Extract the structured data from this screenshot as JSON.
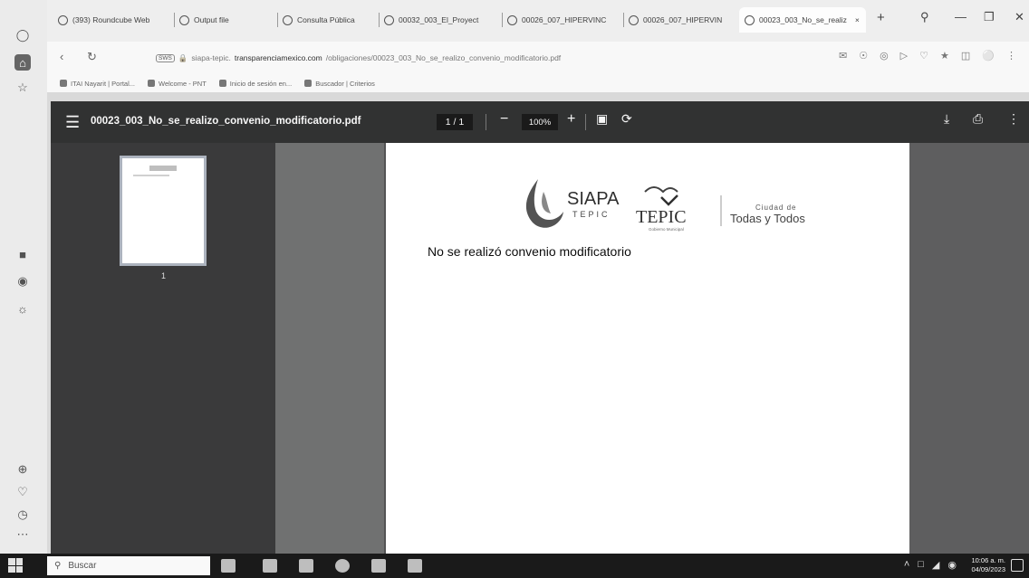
{
  "tabs": [
    {
      "label": "(393) Roundcube Web"
    },
    {
      "label": "Output file"
    },
    {
      "label": "Consulta Pública"
    },
    {
      "label": "00032_003_El_Proyect"
    },
    {
      "label": "00026_007_HIPERVINC"
    },
    {
      "label": "00026_007_HIPERVIN"
    },
    {
      "label": "00023_003_No_se_realiz"
    }
  ],
  "address": {
    "badge": "SWS",
    "prefix": "siapa-tepic.",
    "domain": "transparenciamexico.com",
    "path": "/obligaciones/00023_003_No_se_realizo_convenio_modificatorio.pdf"
  },
  "bookmarks": [
    {
      "label": "ITAI Nayarit | Portal..."
    },
    {
      "label": "Welcome - PNT"
    },
    {
      "label": "Inicio de sesión en..."
    },
    {
      "label": "Buscador | Criterios"
    }
  ],
  "viewer": {
    "filename": "00023_003_No_se_realizo_convenio_modificatorio.pdf",
    "page_indicator": "1 / 1",
    "zoom": "100%",
    "thumb_label": "1"
  },
  "document": {
    "logo_siapa": "SIAPA",
    "logo_siapa_sub": "TEPIC",
    "logo_tepic": "TEPIC",
    "logo_tepic_sub": "Gobierno Municipal",
    "logo_ciudad": "Ciudad de",
    "logo_todas": "Todas y Todos",
    "body": "No se realizó convenio modificatorio"
  },
  "taskbar": {
    "search_placeholder": "Buscar",
    "time": "10:06 a. m.",
    "date": "04/09/2023"
  }
}
